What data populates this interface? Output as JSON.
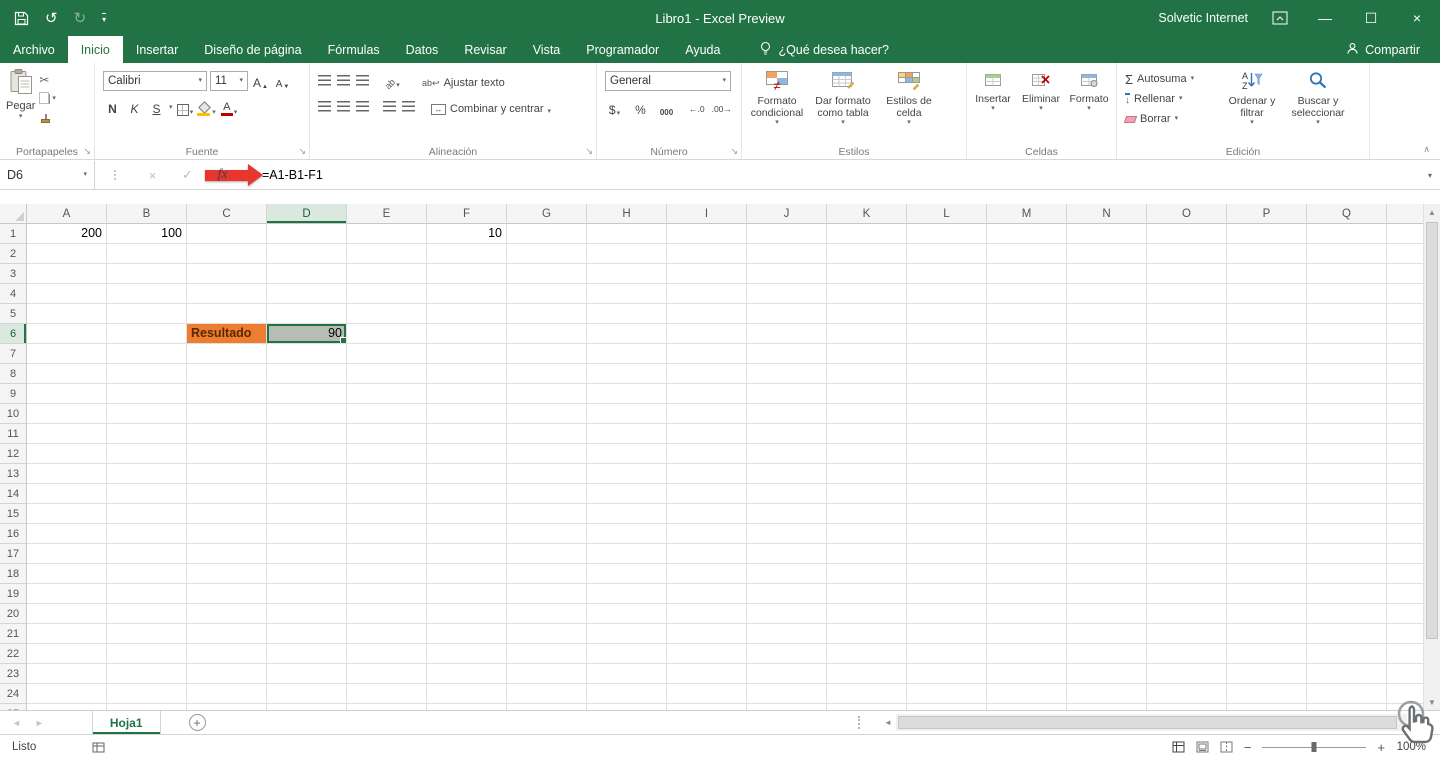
{
  "titlebar": {
    "title": "Libro1 - Excel Preview",
    "user": "Solvetic Internet"
  },
  "tabs": {
    "items": [
      "Archivo",
      "Inicio",
      "Insertar",
      "Diseño de página",
      "Fórmulas",
      "Datos",
      "Revisar",
      "Vista",
      "Programador",
      "Ayuda"
    ],
    "active": "Inicio",
    "tell_me": "¿Qué desea hacer?",
    "share": "Compartir"
  },
  "ribbon": {
    "clipboard": {
      "paste": "Pegar",
      "group": "Portapapeles"
    },
    "font": {
      "name": "Calibri",
      "size": "11",
      "bold": "N",
      "italic": "K",
      "underline": "S",
      "group": "Fuente"
    },
    "alignment": {
      "wrap": "Ajustar texto",
      "merge": "Combinar y centrar",
      "group": "Alineación"
    },
    "number": {
      "format": "General",
      "currency": "$",
      "percent": "%",
      "thousands": "000",
      "increase_decimal": "←.0",
      "decrease_decimal": ".00→",
      "group": "Número"
    },
    "styles": {
      "conditional": "Formato condicional",
      "format_table": "Dar formato como tabla",
      "cell_styles": "Estilos de celda",
      "group": "Estilos"
    },
    "cells": {
      "insert": "Insertar",
      "delete": "Eliminar",
      "format": "Formato",
      "group": "Celdas"
    },
    "editing": {
      "autosum": "Autosuma",
      "fill": "Rellenar",
      "clear": "Borrar",
      "sort": "Ordenar y filtrar",
      "find": "Buscar y seleccionar",
      "group": "Edición"
    }
  },
  "formula_bar": {
    "name_box": "D6",
    "fx": "fx",
    "formula": "=A1-B1-F1"
  },
  "grid": {
    "columns": [
      "A",
      "B",
      "C",
      "D",
      "E",
      "F",
      "G",
      "H",
      "I",
      "J",
      "K",
      "L",
      "M",
      "N",
      "O",
      "P",
      "Q"
    ],
    "row_count": 25,
    "selected_cell": "D6",
    "selected_column": "D",
    "selected_row": 6,
    "cells": {
      "A1": {
        "value": "200",
        "align": "right"
      },
      "B1": {
        "value": "100",
        "align": "right"
      },
      "F1": {
        "value": "10",
        "align": "right"
      },
      "C6": {
        "value": "Resultado",
        "cls": "resultado"
      },
      "D6": {
        "value": "90",
        "align": "right",
        "cls": "grayfill"
      }
    },
    "colors": {
      "accent_green": "#217346",
      "result_fill": "#ED7D31",
      "selected_cell_fill": "#b7bdb3",
      "annotation_red": "#e8352e"
    }
  },
  "sheet_bar": {
    "tabs": [
      "Hoja1"
    ]
  },
  "status_bar": {
    "mode": "Listo",
    "zoom": "100%"
  }
}
